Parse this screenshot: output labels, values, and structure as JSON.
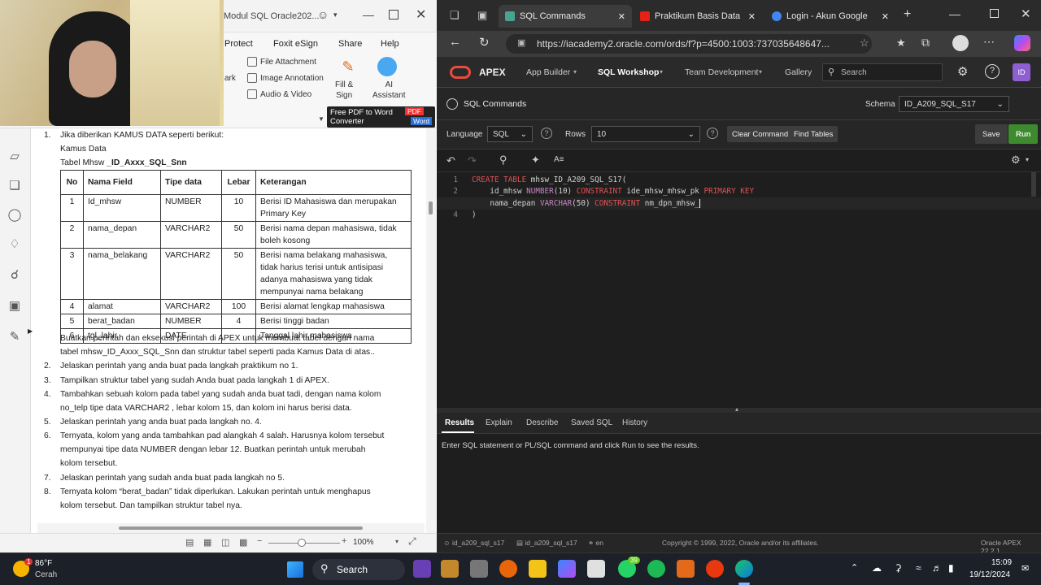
{
  "pdf": {
    "window_title": "Modul SQL Oracle202...",
    "ribbon_tabs": [
      "Protect",
      "Foxit eSign",
      "Share",
      "Help"
    ],
    "ribbon_items": [
      "File Attachment",
      "Image Annotation",
      "Audio & Video"
    ],
    "ribbon_partial": "ark",
    "fill_sign": "Fill &\nSign",
    "ai_assistant": "AI\nAssistant",
    "promo_line1": "Free PDF to Word",
    "promo_line2": "Converter",
    "promo_badge1": "PDF",
    "promo_badge2": "Word",
    "zoom": "100%",
    "content": {
      "item1_intro": "Jika diberikan KAMUS DATA seperti berikut:",
      "kamus_label": "Kamus Data",
      "table_label_prefix": "Tabel Mhsw ",
      "table_label_bold": "_ID_Axxx_SQL_Snn",
      "columns": [
        "No",
        "Nama Field",
        "Tipe data",
        "Lebar",
        "Keterangan"
      ],
      "rows": [
        [
          "1",
          "Id_mhsw",
          "NUMBER",
          "10",
          "Berisi ID Mahasiswa dan merupakan Primary Key"
        ],
        [
          "2",
          "nama_depan",
          "VARCHAR2",
          "50",
          "Berisi nama depan mahasiswa, tidak boleh kosong"
        ],
        [
          "3",
          "nama_belakang",
          "VARCHAR2",
          "50",
          "Berisi nama belakang mahasiswa, tidak harius terisi untuk antisipasi adanya mahasiswa yang tidak mempunyai nama belakang"
        ],
        [
          "4",
          "alamat",
          "VARCHAR2",
          "100",
          "Berisi alamat lengkap mahasiswa"
        ],
        [
          "5",
          "berat_badan",
          "NUMBER",
          "4",
          "Berisi tinggi badan"
        ],
        [
          "6",
          "tgl_lahir",
          "DATE",
          "",
          "Tanggal lahir mahasiswa"
        ]
      ],
      "after_table_1": "Buatkan perintah dan eksekusi perintah di APEX untuk membuat tabel dengan  nama",
      "after_table_2": "tabel mhsw_ID_Axxx_SQL_Snn dan struktur tabel seperti pada Kamus Data di atas..",
      "items": [
        {
          "num": "2.",
          "lines": [
            "Jelaskan perintah yang anda buat pada langkah praktikum no 1."
          ]
        },
        {
          "num": "3.",
          "lines": [
            "Tampilkan struktur tabel yang sudah Anda buat pada langkah 1 di APEX."
          ]
        },
        {
          "num": "4.",
          "lines": [
            "Tambahkan sebuah kolom pada tabel yang sudah anda buat tadi, dengan nama kolom",
            "no_telp tipe data VARCHAR2 , lebar kolom 15, dan kolom ini harus berisi data."
          ]
        },
        {
          "num": "5.",
          "lines": [
            "Jelaskan perintah yang anda buat pada langkah no. 4."
          ]
        },
        {
          "num": "6.",
          "lines": [
            "Ternyata, kolom yang anda tambahkan pad alangkah 4 salah. Harusnya kolom tersebut",
            "mempunyai tipe data NUMBER dengan lebar 12. Buatkan perintah untuk merubah",
            "kolom tersebut."
          ]
        },
        {
          "num": "7.",
          "lines": [
            "Jelaskan perintah yang sudah anda buat pada langkah no 5."
          ]
        },
        {
          "num": "8.",
          "lines": [
            "Ternyata kolom “berat_badan” tidak diperlukan. Lakukan perintah untuk menghapus",
            "kolom tersebut. Dan tampilkan struktur tabel nya."
          ]
        }
      ]
    }
  },
  "browser": {
    "tabs": [
      {
        "label": "SQL Commands",
        "color": "#4aa391",
        "active": true
      },
      {
        "label": "Praktikum Basis Data Mo",
        "color": "#e62117",
        "active": false
      },
      {
        "label": "Login - Akun Google",
        "color": "#4285f4",
        "active": false
      }
    ],
    "url": "https://iacademy2.oracle.com/ords/f?p=4500:1003:737035648647..."
  },
  "apex": {
    "brand": "APEX",
    "nav": [
      "App Builder",
      "SQL Workshop",
      "Team Development",
      "Gallery"
    ],
    "search_placeholder": "Search",
    "user_initials": "ID",
    "page_title": "SQL Commands",
    "schema_label": "Schema",
    "schema_value": "ID_A209_SQL_S17",
    "language_label": "Language",
    "language_value": "SQL",
    "rows_label": "Rows",
    "rows_value": "10",
    "clear_command": "Clear Command",
    "find_tables": "Find Tables",
    "save": "Save",
    "run": "Run",
    "code_line1_kw": "CREATE TABLE",
    "code_line1_rest": " mhsw_ID_A209_SQL_S17(",
    "code_line2_a": "    id_mhsw ",
    "code_line2_ty": "NUMBER",
    "code_line2_b": "(10) ",
    "code_line2_kw1": "CONSTRAINT",
    "code_line2_c": " ide_mhsw_mhsw_pk ",
    "code_line2_kw2": "PRIMARY KEY",
    "code_line3_a": "    nama_depan ",
    "code_line3_ty": "VARCHAR",
    "code_line3_b": "(50) ",
    "code_line3_kw": "CONSTRAINT",
    "code_line3_c": " nm_dpn_mhsw_",
    "code_line4": ")",
    "line_numbers": [
      "1",
      "2",
      "3",
      "4"
    ],
    "result_tabs": [
      "Results",
      "Explain",
      "Describe",
      "Saved SQL",
      "History"
    ],
    "results_message": "Enter SQL statement or PL/SQL command and click Run to see the results.",
    "footer_user": "id_a209_sql_s17",
    "footer_schema": "id_a209_sql_s17",
    "footer_lang": "en",
    "footer_copyright": "Copyright © 1999, 2022, Oracle and/or its affiliates.",
    "footer_version": "Oracle APEX 22.2.1"
  },
  "taskbar": {
    "weather_temp": "86°F",
    "weather_desc": "Cerah",
    "weather_badge": "1",
    "search_label": "Search",
    "notify_count": "39",
    "time": "15:09",
    "date": "19/12/2024"
  }
}
